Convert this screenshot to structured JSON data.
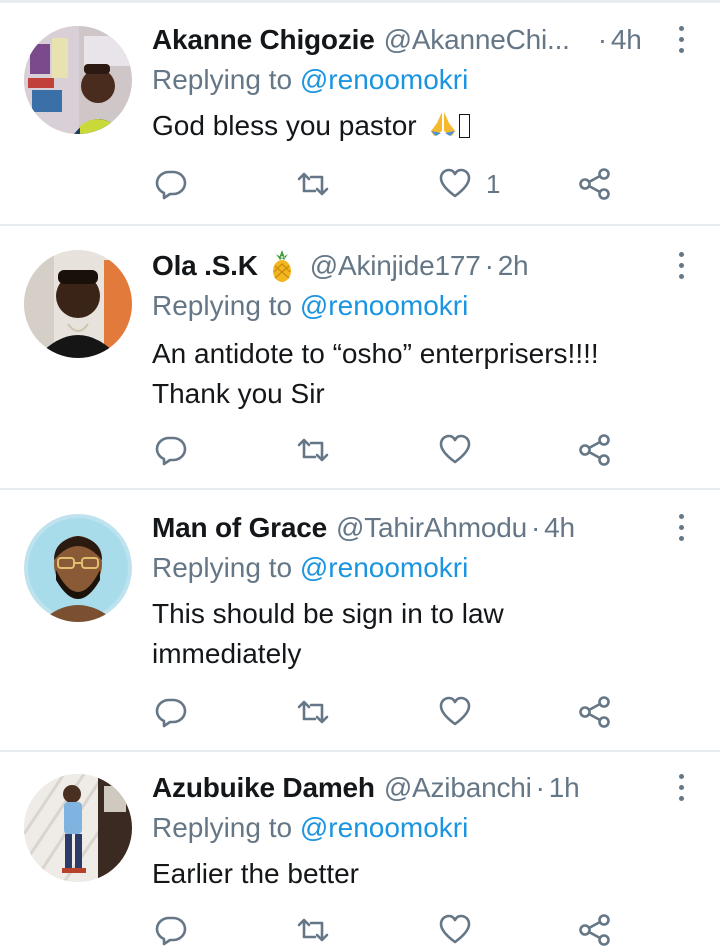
{
  "tweets": [
    {
      "name": "Akanne Chigozie",
      "handle": "@AkanneChi...",
      "dot": "·",
      "time": "4h",
      "replying_prefix": "Replying to",
      "replying_to": "@renoomokri",
      "text_lines": [
        "God bless you pastor"
      ],
      "emoji_icon": "folded-hands-icon",
      "like_count": "1"
    },
    {
      "name": "Ola .S.K",
      "name_emoji_icon": "pineapple-icon",
      "handle": "@Akinjide177",
      "dot": "·",
      "time": "2h",
      "replying_prefix": "Replying to",
      "replying_to": "@renoomokri",
      "text_lines": [
        "An antidote to “osho” enterprisers!!!!",
        "Thank you Sir"
      ],
      "like_count": ""
    },
    {
      "name": "Man of Grace",
      "handle": "@TahirAhmodu",
      "dot": "·",
      "time": "4h",
      "replying_prefix": "Replying to",
      "replying_to": "@renoomokri",
      "text_lines": [
        "This should be sign in to law",
        "immediately"
      ],
      "like_count": ""
    },
    {
      "name": "Azubuike Dameh",
      "handle": "@Azibanchi",
      "dot": "·",
      "time": "1h",
      "replying_prefix": "Replying to",
      "replying_to": "@renoomokri",
      "text_lines": [
        "Earlier the better"
      ],
      "like_count": ""
    }
  ],
  "colors": {
    "text": "#14171a",
    "secondary": "#657786",
    "link": "#1b95e0",
    "divider": "#e6ecf0"
  },
  "icons": [
    "reply-icon",
    "retweet-icon",
    "like-icon",
    "share-icon",
    "more-options-icon"
  ]
}
